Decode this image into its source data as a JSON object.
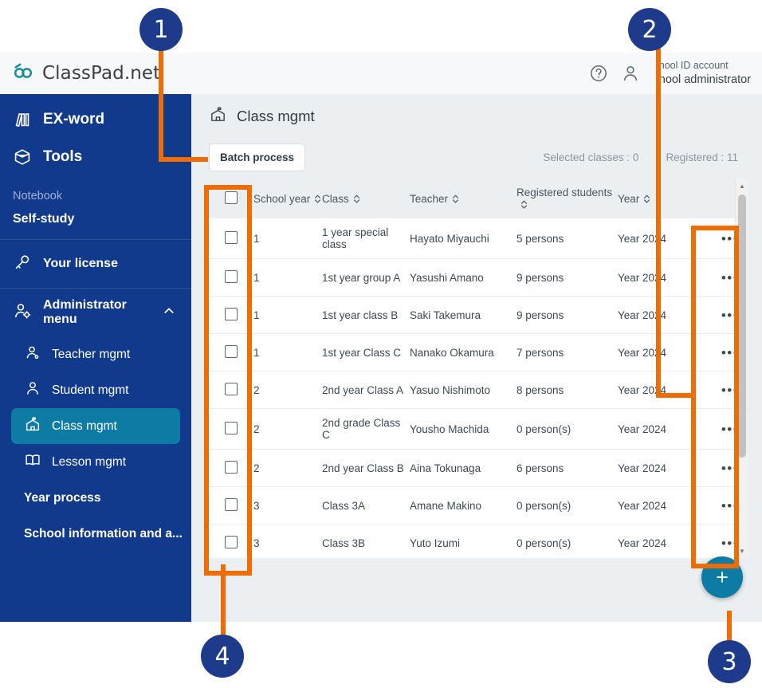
{
  "colors": {
    "sidebar_bg": "#123a8c",
    "active_item": "#0d7ba4",
    "accent_teal": "#0d7ba4",
    "annotation_orange": "#ef6c00",
    "badge_navy": "#1e3a8a",
    "content_bg": "#eceff1"
  },
  "topbar": {
    "logo_icon": "classpad-link-logo-icon",
    "logo_text": "ClassPad.net",
    "help_icon": "help-circle-icon",
    "account_icon": "user-icon",
    "account_line1": "hool ID account",
    "account_line2": "hool administrator"
  },
  "sidebar": {
    "top_items": [
      {
        "label": "EX-word",
        "icon": "books-icon"
      },
      {
        "label": "Tools",
        "icon": "toolbox-icon"
      }
    ],
    "notebook_label": "Notebook",
    "self_study_label": "Self-study",
    "license": {
      "label": "Your license",
      "icon": "key-icon"
    },
    "admin": {
      "label": "Administrator menu",
      "icon": "user-gear-icon",
      "chevron": "chevron-up-icon"
    },
    "admin_items": [
      {
        "label": "Teacher mgmt",
        "icon": "teacher-icon",
        "active": false
      },
      {
        "label": "Student mgmt",
        "icon": "student-icon",
        "active": false
      },
      {
        "label": "Class mgmt",
        "icon": "school-building-icon",
        "active": true
      },
      {
        "label": "Lesson mgmt",
        "icon": "open-book-icon",
        "active": false
      }
    ],
    "plain_items": [
      {
        "label": "Year process"
      },
      {
        "label": "School information and a..."
      }
    ]
  },
  "page": {
    "title": "Class mgmt",
    "title_icon": "school-building-icon",
    "batch_button": "Batch process",
    "selected_counter": "Selected classes : 0",
    "registered_counter": "Registered : 11"
  },
  "table": {
    "headers": [
      {
        "label": "",
        "sortable": false
      },
      {
        "label": "School year",
        "sortable": true
      },
      {
        "label": "Class",
        "sortable": true
      },
      {
        "label": "Teacher",
        "sortable": true
      },
      {
        "label": "Registered students",
        "sortable": true
      },
      {
        "label": "Year",
        "sortable": true
      },
      {
        "label": "",
        "sortable": false
      }
    ],
    "rows": [
      {
        "school_year": "1",
        "class": "1 year special class",
        "teacher": "Hayato Miyauchi",
        "registered": "5 persons",
        "year": "Year 2024"
      },
      {
        "school_year": "1",
        "class": "1st year group A",
        "teacher": "Yasushi Amano",
        "registered": "9 persons",
        "year": "Year 2024"
      },
      {
        "school_year": "1",
        "class": "1st year class B",
        "teacher": "Saki Takemura",
        "registered": "9 persons",
        "year": "Year 2024"
      },
      {
        "school_year": "1",
        "class": "1st year Class C",
        "teacher": "Nanako Okamura",
        "registered": "7 persons",
        "year": "Year 2024"
      },
      {
        "school_year": "2",
        "class": "2nd year Class A",
        "teacher": "Yasuo Nishimoto",
        "registered": "8 persons",
        "year": "Year 2024"
      },
      {
        "school_year": "2",
        "class": "2nd grade Class C",
        "teacher": "Yousho Machida",
        "registered": "0 person(s)",
        "year": "Year 2024"
      },
      {
        "school_year": "2",
        "class": "2nd year Class B",
        "teacher": "Aina Tokunaga",
        "registered": "6 persons",
        "year": "Year 2024"
      },
      {
        "school_year": "3",
        "class": "Class 3A",
        "teacher": "Amane Makino",
        "registered": "0 person(s)",
        "year": "Year 2024"
      },
      {
        "school_year": "3",
        "class": "Class 3B",
        "teacher": "Yuto Izumi",
        "registered": "0 person(s)",
        "year": "Year 2024"
      }
    ],
    "row_menu_glyph": "•••"
  },
  "fab": {
    "label": "+",
    "icon": "plus-icon"
  },
  "annotations": [
    {
      "number": "1",
      "target": "batch-process-button"
    },
    {
      "number": "2",
      "target": "row-overflow-menu"
    },
    {
      "number": "3",
      "target": "add-class-fab"
    },
    {
      "number": "4",
      "target": "row-checkbox-column"
    }
  ]
}
